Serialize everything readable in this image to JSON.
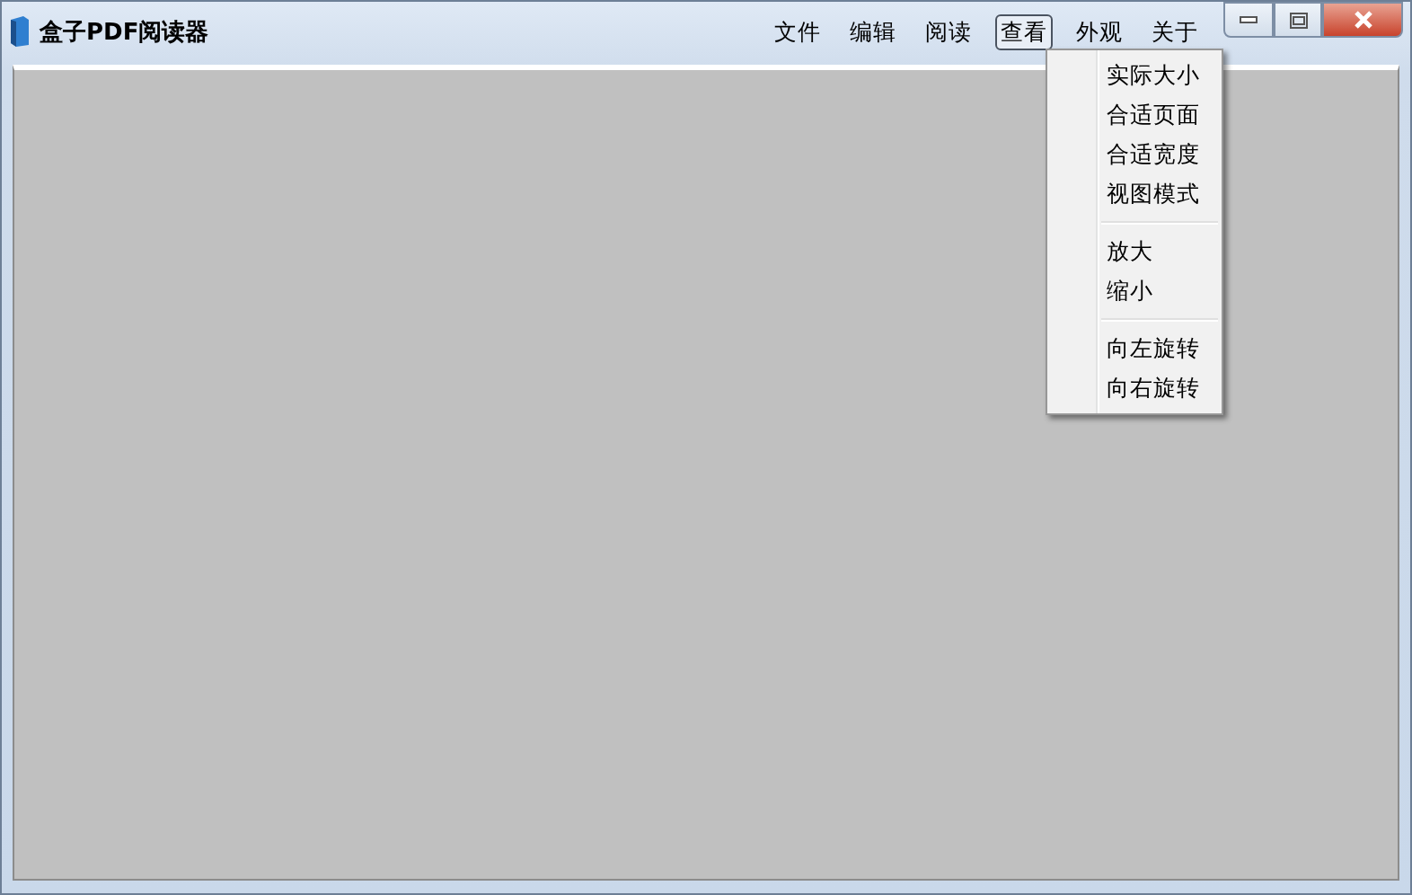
{
  "window": {
    "title": "盒子PDF阅读器"
  },
  "menu": [
    {
      "label": "文件",
      "selected": false
    },
    {
      "label": "编辑",
      "selected": false
    },
    {
      "label": "阅读",
      "selected": false
    },
    {
      "label": "查看",
      "selected": true
    },
    {
      "label": "外观",
      "selected": false
    },
    {
      "label": "关于",
      "selected": false
    }
  ],
  "dropdown": {
    "groups": [
      [
        "实际大小",
        "合适页面",
        "合适宽度",
        "视图模式"
      ],
      [
        "放大",
        "缩小"
      ],
      [
        "向左旋转",
        "向右旋转"
      ]
    ]
  }
}
